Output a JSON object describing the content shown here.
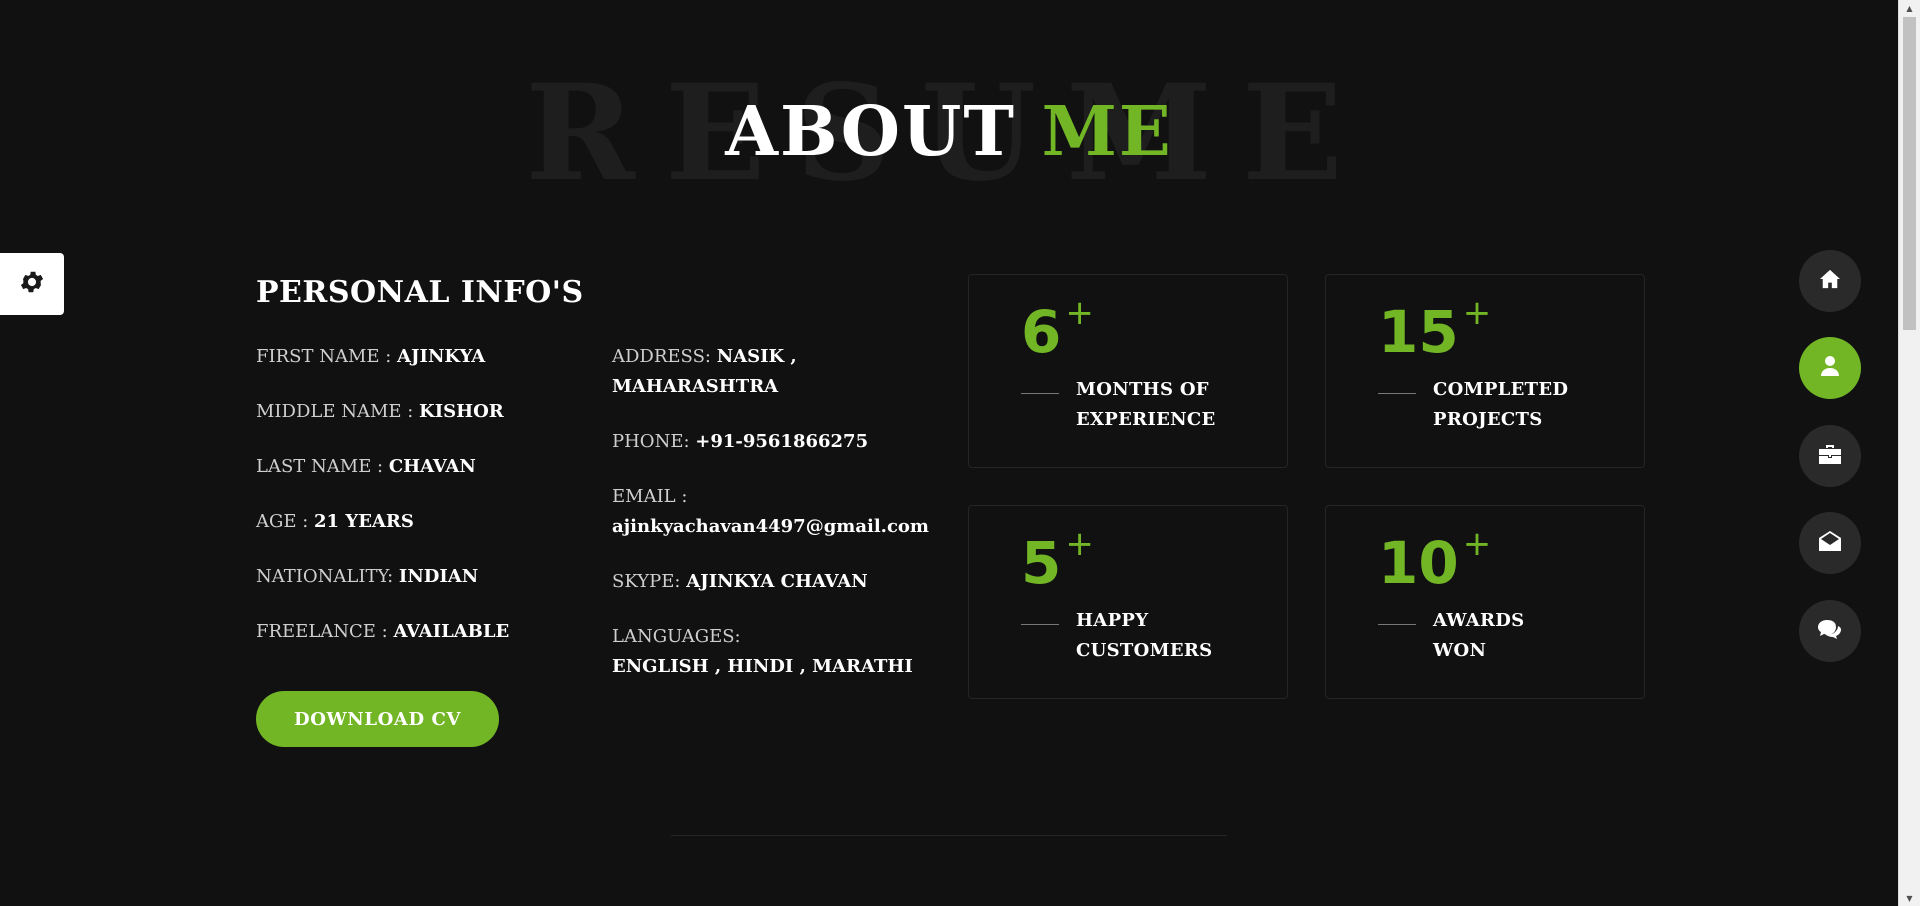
{
  "heading": {
    "background_word": "RESUME",
    "title_main": "ABOUT",
    "title_accent": "ME"
  },
  "personal_info": {
    "title": "PERSONAL INFO'S",
    "left_column": [
      {
        "label": "FIRST NAME : ",
        "value": "AJINKYA"
      },
      {
        "label": "MIDDLE NAME : ",
        "value": "KISHOR"
      },
      {
        "label": "LAST NAME : ",
        "value": "CHAVAN"
      },
      {
        "label": "AGE : ",
        "value": "21 YEARS"
      },
      {
        "label": "NATIONALITY: ",
        "value": "INDIAN"
      },
      {
        "label": "FREELANCE : ",
        "value": "AVAILABLE"
      }
    ],
    "right_column": [
      {
        "label": "ADDRESS: ",
        "value": "NASIK , MAHARASHTRA"
      },
      {
        "label": "PHONE: ",
        "value": "+91-9561866275"
      },
      {
        "label": "EMAIL : ",
        "value": "ajinkyachavan4497@gmail.com"
      },
      {
        "label": "SKYPE: ",
        "value": "AJINKYA CHAVAN"
      },
      {
        "label": "LANGUAGES:",
        "value": "ENGLISH , HINDI , MARATHI"
      }
    ],
    "download_button": "DOWNLOAD CV"
  },
  "stats": [
    {
      "number": "6",
      "suffix": "+",
      "label_line1": "MONTHS OF",
      "label_line2": "EXPERIENCE"
    },
    {
      "number": "15",
      "suffix": "+",
      "label_line1": "COMPLETED",
      "label_line2": "PROJECTS"
    },
    {
      "number": "5",
      "suffix": "+",
      "label_line1": "HAPPY",
      "label_line2": "CUSTOMERS"
    },
    {
      "number": "10",
      "suffix": "+",
      "label_line1": "AWARDS",
      "label_line2": "WON"
    }
  ],
  "side_nav": [
    {
      "icon": "home-icon",
      "active": false
    },
    {
      "icon": "user-icon",
      "active": true
    },
    {
      "icon": "briefcase-icon",
      "active": false
    },
    {
      "icon": "envelope-open-icon",
      "active": false
    },
    {
      "icon": "chat-icon",
      "active": false
    }
  ],
  "settings_icon": "gear-icon",
  "colors": {
    "accent": "#72b626",
    "background": "#111111",
    "nav_button": "#2b2a2a"
  }
}
